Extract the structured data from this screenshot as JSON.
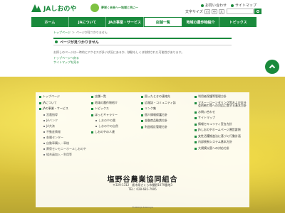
{
  "header": {
    "logo_text": "JAしおのや",
    "slogan": "夢咲く未来へ～地域と共に～",
    "utility_links": [
      "お問い合わせ",
      "サイトマップ"
    ],
    "text_size_label": "文字サイズ",
    "text_sizes": [
      "小",
      "中",
      "大"
    ]
  },
  "nav": {
    "items": [
      "ホーム",
      "JAについて",
      "JAの事業・サービス",
      "店舗一覧",
      "地域の農作物紹介",
      "トピックス"
    ],
    "active_index": 3
  },
  "content": {
    "breadcrumb": [
      "トップページ",
      "ページが見つかりません"
    ],
    "heading": "ページが見つかりません",
    "message": "お探しのページは一時的にアクセスが多い状況にあるか、移動もしくは削除された可能性があります。",
    "links": [
      "トップページへ戻る",
      "サイトマップを見る"
    ]
  },
  "footer": {
    "col1": [
      {
        "label": "トップページ",
        "sub": false
      },
      {
        "label": "JAについて",
        "sub": false
      },
      {
        "label": "JAの事業・サービス",
        "sub": false
      },
      {
        "label": "営農指導",
        "sub": true
      },
      {
        "label": "JAバンク",
        "sub": true
      },
      {
        "label": "JA共済",
        "sub": true
      },
      {
        "label": "不動産情報",
        "sub": true
      },
      {
        "label": "各種センター",
        "sub": true
      },
      {
        "label": "自動車購入・車検",
        "sub": true
      },
      {
        "label": "葬祭セレモニーホールしおのや",
        "sub": true
      },
      {
        "label": "組合員加入・利用等",
        "sub": true
      }
    ],
    "col2": [
      {
        "label": "店舗一覧",
        "sub": false
      },
      {
        "label": "地域の農作物紹介",
        "sub": false
      },
      {
        "label": "トピックス",
        "sub": false
      },
      {
        "label": "ほっとギャラリー",
        "sub": false
      },
      {
        "label": "しおのやの農",
        "sub": true
      },
      {
        "label": "しおのやの自然",
        "sub": true
      },
      {
        "label": "しおのやの人達",
        "sub": false
      }
    ],
    "col3": [
      {
        "label": "困ったときの連絡先",
        "sub": false
      },
      {
        "label": "広報誌・コミュニティ誌",
        "sub": false
      },
      {
        "label": "リンク集",
        "sub": false
      },
      {
        "label": "個人情報保護方針",
        "sub": false
      },
      {
        "label": "金融商品勧誘方針",
        "sub": false
      },
      {
        "label": "利益相反管理方針",
        "sub": false
      }
    ],
    "col4": [
      {
        "label": "利用者保護等管理方針",
        "sub": false
      },
      {
        "label": "マネー・ローンダリング等および反社会的勢力等への対応に関する基本方針",
        "sub": false
      },
      {
        "label": "お問い合わせ",
        "sub": false
      },
      {
        "label": "サイトマップ",
        "sub": false
      },
      {
        "label": "情報セキュリティ宣言方針",
        "sub": false
      },
      {
        "label": "JAしおのやホームページ運営要領",
        "sub": false
      },
      {
        "label": "女性活躍推進法に基づく行動計画",
        "sub": false
      },
      {
        "label": "内部統制システム基本方針",
        "sub": false
      },
      {
        "label": "大規模災害への対応方針",
        "sub": false
      }
    ],
    "org_name": "塩野谷農業協同組合",
    "address": "〒329-1312　栃木県さくら市櫻野1079番地3",
    "tel": "TEL：028-681-7995",
    "copyright": "©2020 JA Shionoya"
  }
}
